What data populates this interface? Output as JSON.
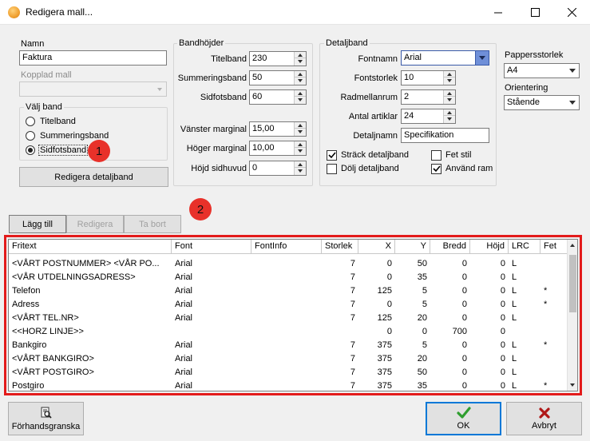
{
  "window": {
    "title": "Redigera mall..."
  },
  "namn": {
    "label": "Namn",
    "value": "Faktura"
  },
  "kopplad_mall": {
    "label": "Kopplad mall",
    "value": ""
  },
  "valj_band": {
    "title": "Välj band",
    "options": [
      "Titelband",
      "Summeringsband",
      "Sidfotsband"
    ],
    "selected": "Sidfotsband"
  },
  "redigera_detaljband": "Redigera detaljband",
  "bandhojder": {
    "title": "Bandhöjder",
    "fields": [
      {
        "label": "Titelband",
        "value": "230"
      },
      {
        "label": "Summeringsband",
        "value": "50"
      },
      {
        "label": "Sidfotsband",
        "value": "60"
      },
      {
        "label": "Vänster marginal",
        "value": "15,00"
      },
      {
        "label": "Höger marginal",
        "value": "10,00"
      },
      {
        "label": "Höjd sidhuvud",
        "value": "0"
      }
    ]
  },
  "detaljband": {
    "title": "Detaljband",
    "fontnamn": {
      "label": "Fontnamn",
      "value": "Arial"
    },
    "fontstorlek": {
      "label": "Fontstorlek",
      "value": "10"
    },
    "radmellanrum": {
      "label": "Radmellanrum",
      "value": "2"
    },
    "antal_artiklar": {
      "label": "Antal artiklar",
      "value": "24"
    },
    "detaljnamn": {
      "label": "Detaljnamn",
      "value": "Specifikation"
    },
    "checks": [
      {
        "label": "Sträck detaljband",
        "checked": true
      },
      {
        "label": "Fet stil",
        "checked": false
      },
      {
        "label": "Dölj detaljband",
        "checked": false
      },
      {
        "label": "Använd ram",
        "checked": true
      }
    ]
  },
  "pappersstorlek": {
    "label": "Pappersstorlek",
    "value": "A4"
  },
  "orientering": {
    "label": "Orientering",
    "value": "Stående"
  },
  "badges": [
    "1",
    "2"
  ],
  "list_buttons": {
    "add": "Lägg till",
    "edit": "Redigera",
    "delete": "Ta bort"
  },
  "grid": {
    "columns": [
      "Fritext",
      "Font",
      "FontInfo",
      "Storlek",
      "X",
      "Y",
      "Bredd",
      "Höjd",
      "LRC",
      "Fet"
    ],
    "rows": [
      [
        "<VÅRT POSTNUMMER>  <VÅR PO...",
        "Arial",
        "",
        "7",
        "0",
        "50",
        "0",
        "0",
        "L",
        ""
      ],
      [
        "<VÅR UTDELNINGSADRESS>",
        "Arial",
        "",
        "7",
        "0",
        "35",
        "0",
        "0",
        "L",
        ""
      ],
      [
        "Telefon",
        "Arial",
        "",
        "7",
        "125",
        "5",
        "0",
        "0",
        "L",
        "*"
      ],
      [
        "Adress",
        "Arial",
        "",
        "7",
        "0",
        "5",
        "0",
        "0",
        "L",
        "*"
      ],
      [
        "<VÅRT TEL.NR>",
        "Arial",
        "",
        "7",
        "125",
        "20",
        "0",
        "0",
        "L",
        ""
      ],
      [
        "<<HORZ LINJE>>",
        "",
        "",
        "",
        "0",
        "0",
        "700",
        "0",
        "",
        ""
      ],
      [
        "Bankgiro",
        "Arial",
        "",
        "7",
        "375",
        "5",
        "0",
        "0",
        "L",
        "*"
      ],
      [
        "<VÅRT BANKGIRO>",
        "Arial",
        "",
        "7",
        "375",
        "20",
        "0",
        "0",
        "L",
        ""
      ],
      [
        "<VÅRT POSTGIRO>",
        "Arial",
        "",
        "7",
        "375",
        "50",
        "0",
        "0",
        "L",
        ""
      ],
      [
        "Postgiro",
        "Arial",
        "",
        "7",
        "375",
        "35",
        "0",
        "0",
        "L",
        "*"
      ]
    ]
  },
  "bottom": {
    "preview": "Förhandsgranska",
    "ok": "OK",
    "cancel": "Avbryt"
  },
  "colors": {
    "highlight": "#e31b1b",
    "ok_green": "#2f9e2f",
    "cancel_red": "#b01818"
  }
}
